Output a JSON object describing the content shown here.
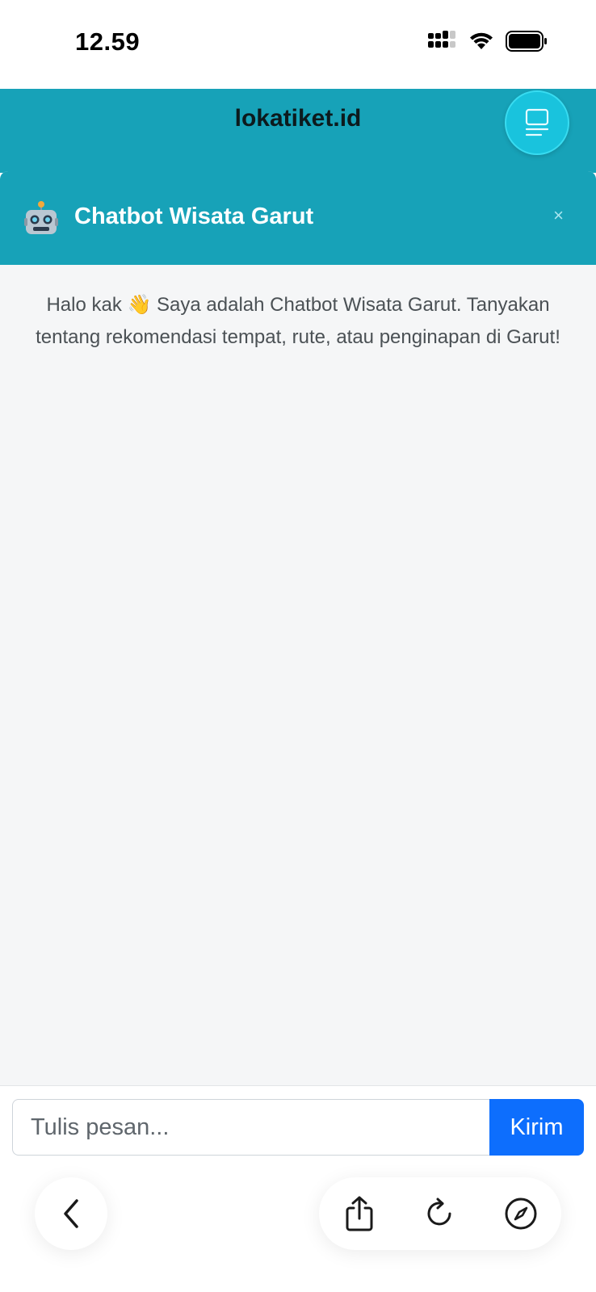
{
  "status_bar": {
    "time": "12.59"
  },
  "header": {
    "site_title": "lokatiket.id",
    "menu_icon": "menu-icon"
  },
  "chat": {
    "title": "Chatbot Wisata Garut",
    "close_label": "×",
    "welcome_message": "Halo kak 👋 Saya adalah Chatbot Wisata Garut. Tanyakan tentang rekomendasi tempat, rute, atau penginapan di Garut!",
    "input_placeholder": "Tulis pesan...",
    "send_label": "Kirim",
    "bot_icon": "robot-icon"
  },
  "colors": {
    "header_bg": "#17a2b8",
    "fab_bg": "#13879a",
    "send_bg": "#0d6efd",
    "panel_bg": "#f5f6f7"
  },
  "browser_toolbar": {
    "icons": [
      "back-icon",
      "share-icon",
      "reload-icon",
      "compass-icon"
    ]
  }
}
